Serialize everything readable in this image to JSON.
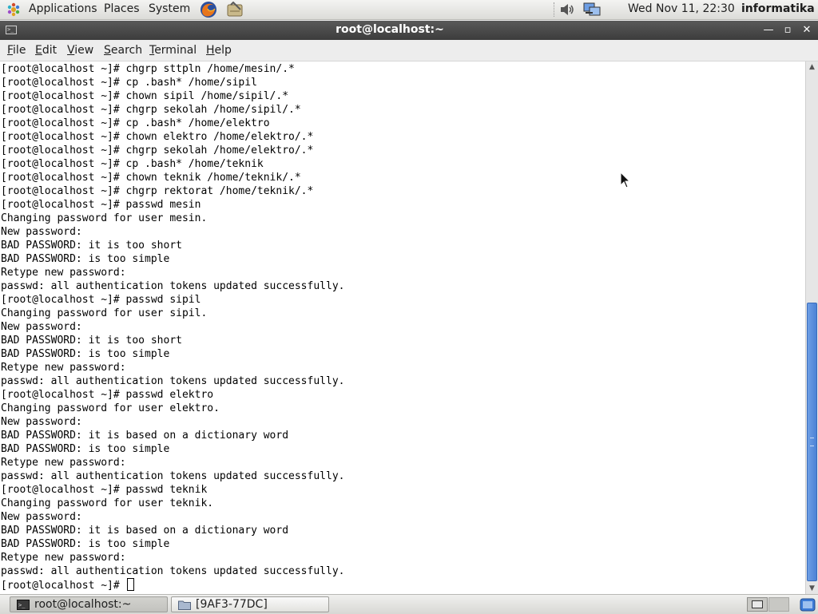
{
  "top_panel": {
    "menus": {
      "applications": "Applications",
      "places": "Places",
      "system": "System"
    },
    "launchers": [
      "firefox-icon",
      "notes-icon"
    ],
    "clock": "Wed Nov 11, 22:30",
    "user": "informatika"
  },
  "window": {
    "title": "root@localhost:~",
    "controls": [
      "minimize-icon",
      "maximize-icon",
      "close-icon"
    ]
  },
  "menubar": [
    {
      "accel": "F",
      "rest": "ile"
    },
    {
      "accel": "E",
      "rest": "dit"
    },
    {
      "accel": "V",
      "rest": "iew"
    },
    {
      "accel": "S",
      "rest": "earch"
    },
    {
      "accel": "T",
      "rest": "erminal"
    },
    {
      "accel": "H",
      "rest": "elp"
    }
  ],
  "terminal": {
    "lines": [
      "[root@localhost ~]# chgrp sttpln /home/mesin/.*",
      "[root@localhost ~]# cp .bash* /home/sipil",
      "[root@localhost ~]# chown sipil /home/sipil/.*",
      "[root@localhost ~]# chgrp sekolah /home/sipil/.*",
      "[root@localhost ~]# cp .bash* /home/elektro",
      "[root@localhost ~]# chown elektro /home/elektro/.*",
      "[root@localhost ~]# chgrp sekolah /home/elektro/.*",
      "[root@localhost ~]# cp .bash* /home/teknik",
      "[root@localhost ~]# chown teknik /home/teknik/.*",
      "[root@localhost ~]# chgrp rektorat /home/teknik/.*",
      "[root@localhost ~]# passwd mesin",
      "Changing password for user mesin.",
      "New password:",
      "BAD PASSWORD: it is too short",
      "BAD PASSWORD: is too simple",
      "Retype new password:",
      "passwd: all authentication tokens updated successfully.",
      "[root@localhost ~]# passwd sipil",
      "Changing password for user sipil.",
      "New password:",
      "BAD PASSWORD: it is too short",
      "BAD PASSWORD: is too simple",
      "Retype new password:",
      "passwd: all authentication tokens updated successfully.",
      "[root@localhost ~]# passwd elektro",
      "Changing password for user elektro.",
      "New password:",
      "BAD PASSWORD: it is based on a dictionary word",
      "BAD PASSWORD: is too simple",
      "Retype new password:",
      "passwd: all authentication tokens updated successfully.",
      "[root@localhost ~]# passwd teknik",
      "Changing password for user teknik.",
      "New password:",
      "BAD PASSWORD: it is based on a dictionary word",
      "BAD PASSWORD: is too simple",
      "Retype new password:",
      "passwd: all authentication tokens updated successfully."
    ],
    "prompt": "[root@localhost ~]# "
  },
  "taskbar": {
    "tasks": [
      {
        "label": "root@localhost:~",
        "icon": "terminal-icon",
        "active": true
      },
      {
        "label": "[9AF3-77DC]",
        "icon": "folder-icon",
        "active": false
      }
    ],
    "workspaces": [
      "workspace-1",
      "workspace-2"
    ],
    "trash_icon": "trash-icon"
  },
  "colors": {
    "titlebar": "#3c3c3c",
    "terminal_bg": "#ffffff",
    "scroll_thumb": "#4c82d6"
  }
}
